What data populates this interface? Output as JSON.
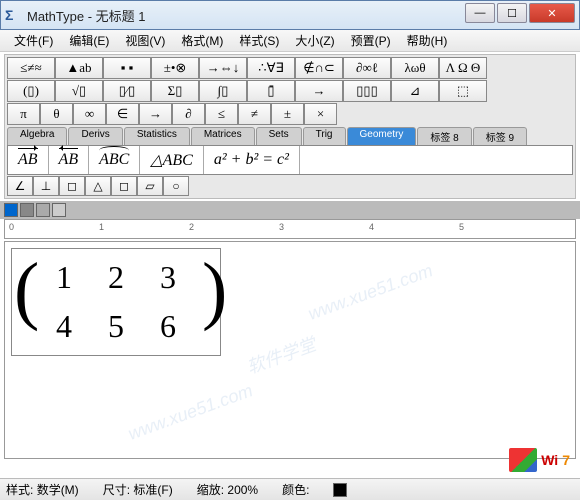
{
  "window": {
    "app_icon": "Σ",
    "title": "MathType - 无标题 1",
    "min": "—",
    "max": "☐",
    "close": "✕"
  },
  "menus": [
    "文件(F)",
    "编辑(E)",
    "视图(V)",
    "格式(M)",
    "样式(S)",
    "大小(Z)",
    "预置(P)",
    "帮助(H)"
  ],
  "symbol_rows": [
    [
      "≤≠≈",
      "▲ab",
      "▪ ▪",
      "±•⊗",
      "→⇔↓",
      "∴∀∃",
      "∉∩⊂",
      "∂∞ℓ",
      "λωθ",
      "Λ Ω Θ"
    ],
    [
      "(▯)",
      "√▯",
      "▯⁄▯",
      "Σ▯",
      "∫▯",
      "▯̄",
      "→",
      "▯▯▯",
      "⊿",
      "⬚"
    ],
    [
      "π",
      "θ",
      "∞",
      "∈",
      "→",
      "∂",
      "≤",
      "≠",
      "±",
      "×"
    ]
  ],
  "tabs": [
    "Algebra",
    "Derivs",
    "Statistics",
    "Matrices",
    "Sets",
    "Trig",
    "Geometry",
    "标签 8",
    "标签 9"
  ],
  "active_tab": "Geometry",
  "expressions": [
    {
      "type": "vec-r",
      "text": "AB"
    },
    {
      "type": "vec-l",
      "text": "AB"
    },
    {
      "type": "arc",
      "text": "ABC"
    },
    {
      "type": "tri",
      "text": "△ABC"
    },
    {
      "type": "pyth",
      "text": "a² + b² = c²"
    }
  ],
  "shapes": [
    "∠",
    "⊥",
    "◻",
    "△",
    "◻",
    "▱",
    "○"
  ],
  "ruler_marks": [
    "0",
    "1",
    "2",
    "3",
    "4",
    "5"
  ],
  "matrix": {
    "rows": [
      [
        "1",
        "2",
        "3"
      ],
      [
        "4",
        "5",
        "6"
      ]
    ]
  },
  "statusbar": {
    "style_label": "样式:",
    "style_value": "数学(M)",
    "size_label": "尺寸:",
    "size_value": "标准(F)",
    "zoom_label": "缩放:",
    "zoom_value": "200%",
    "color_label": "颜色:"
  },
  "corner_logo": {
    "text1": "Wi",
    "text2": "7"
  },
  "watermarks": [
    "www.xue51.com",
    "软件学堂",
    "www.xue51.com"
  ]
}
